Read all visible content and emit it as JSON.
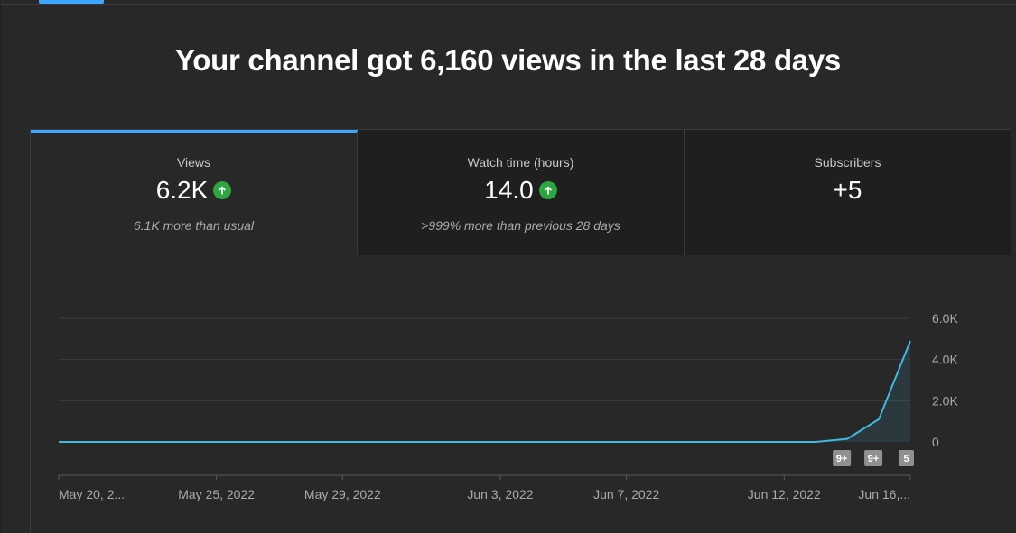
{
  "headline": "Your channel got 6,160 views in the last 28 days",
  "tabs": [
    {
      "label": "Views",
      "value": "6.2K",
      "trend": "up",
      "sub": "6.1K more than usual",
      "active": true
    },
    {
      "label": "Watch time (hours)",
      "value": "14.0",
      "trend": "up",
      "sub": ">999% more than previous 28 days",
      "active": false
    },
    {
      "label": "Subscribers",
      "value": "+5",
      "trend": "",
      "sub": "",
      "active": false
    }
  ],
  "colors": {
    "accent": "#3ea6ff",
    "line": "#41b8e0",
    "trend_up": "#2ba640"
  },
  "chart_data": {
    "type": "area",
    "x": [
      "May 20, 2022",
      "May 21, 2022",
      "May 22, 2022",
      "May 23, 2022",
      "May 24, 2022",
      "May 25, 2022",
      "May 26, 2022",
      "May 27, 2022",
      "May 28, 2022",
      "May 29, 2022",
      "May 30, 2022",
      "May 31, 2022",
      "Jun 1, 2022",
      "Jun 2, 2022",
      "Jun 3, 2022",
      "Jun 4, 2022",
      "Jun 5, 2022",
      "Jun 6, 2022",
      "Jun 7, 2022",
      "Jun 8, 2022",
      "Jun 9, 2022",
      "Jun 10, 2022",
      "Jun 11, 2022",
      "Jun 12, 2022",
      "Jun 13, 2022",
      "Jun 14, 2022",
      "Jun 15, 2022",
      "Jun 16, 2022"
    ],
    "series": [
      {
        "values": [
          0,
          0,
          0,
          0,
          0,
          0,
          0,
          0,
          0,
          0,
          0,
          0,
          0,
          0,
          0,
          0,
          0,
          0,
          0,
          0,
          0,
          0,
          0,
          0,
          0,
          150,
          1100,
          4900
        ]
      }
    ],
    "ylim": [
      0,
      6000
    ],
    "y_ticks": [
      0,
      2000,
      4000,
      6000
    ],
    "y_tick_labels": [
      "0",
      "2.0K",
      "4.0K",
      "6.0K"
    ],
    "x_tick_labels": [
      {
        "index": 0,
        "label": "May 20, 2..."
      },
      {
        "index": 5,
        "label": "May 25, 2022"
      },
      {
        "index": 9,
        "label": "May 29, 2022"
      },
      {
        "index": 14,
        "label": "Jun 3, 2022"
      },
      {
        "index": 18,
        "label": "Jun 7, 2022"
      },
      {
        "index": 23,
        "label": "Jun 12, 2022"
      },
      {
        "index": 27,
        "label": "Jun 16,..."
      }
    ],
    "badges": [
      {
        "index": 25,
        "label": "9+"
      },
      {
        "index": 26,
        "label": "9+"
      },
      {
        "index": 27,
        "label": "5"
      }
    ],
    "grid": true
  }
}
